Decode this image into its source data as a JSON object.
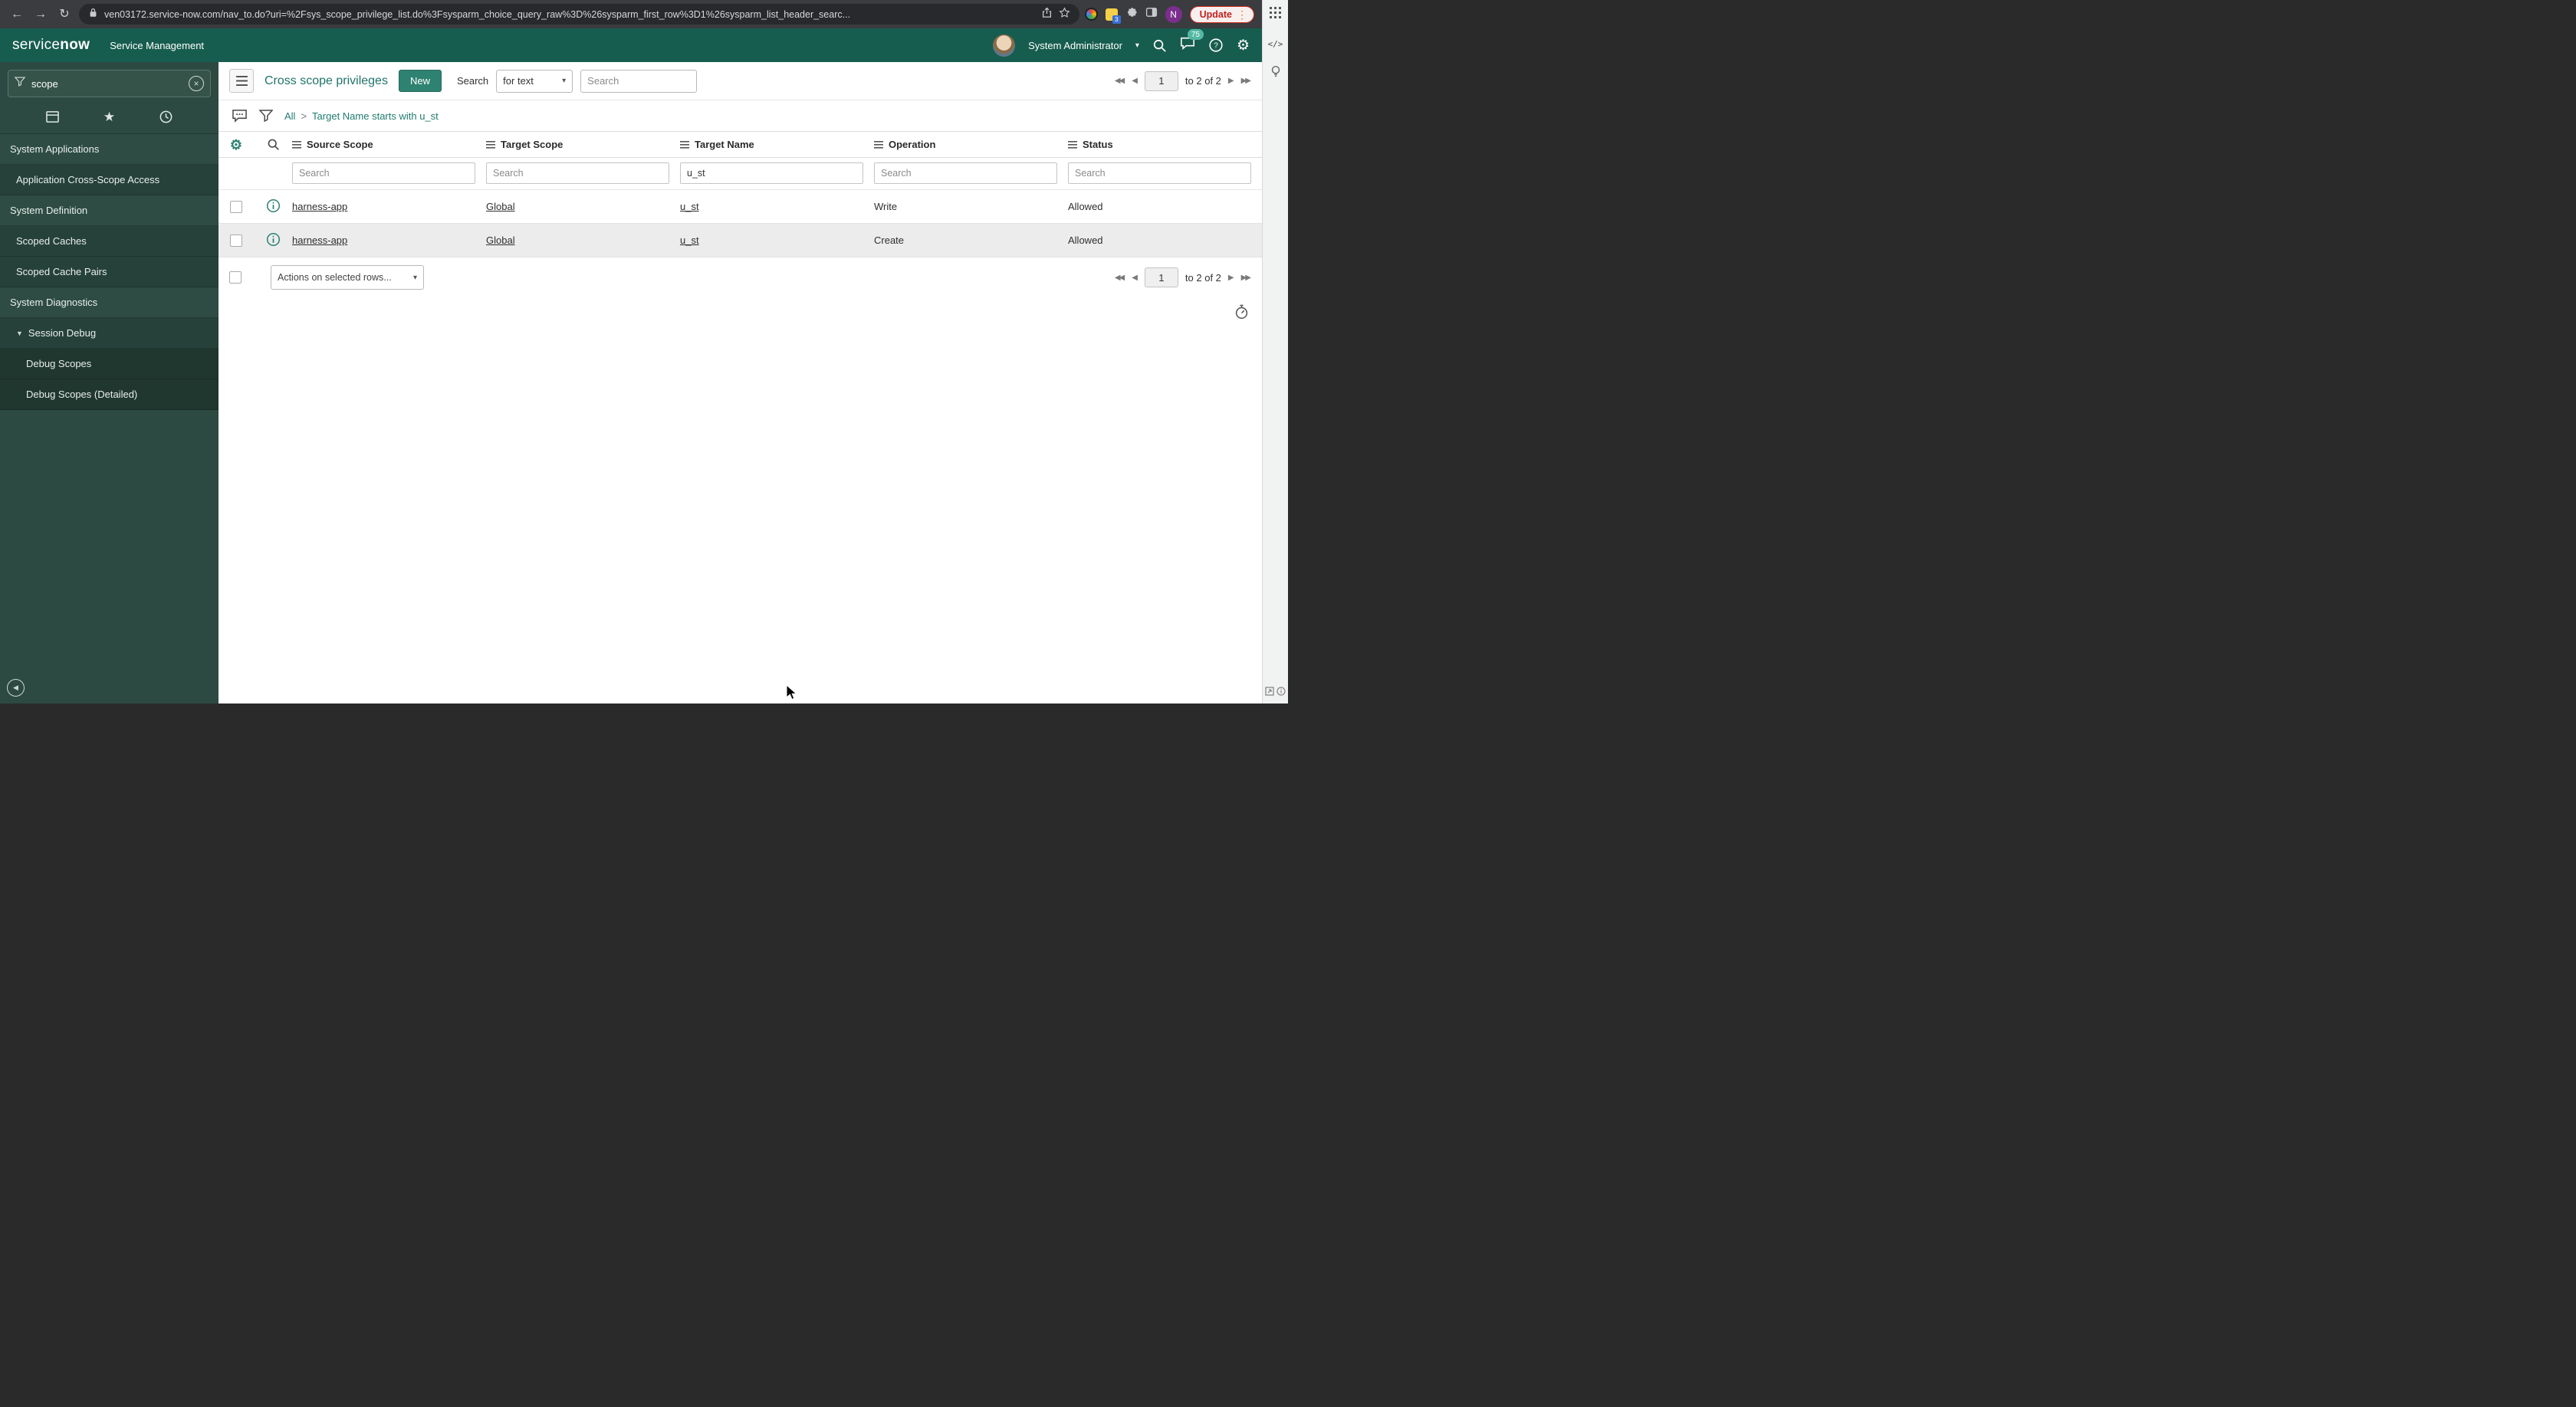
{
  "browser": {
    "url": "ven03172.service-now.com/nav_to.do?uri=%2Fsys_scope_privilege_list.do%3Fsysparm_choice_query_raw%3D%26sysparm_first_row%3D1%26sysparm_list_header_searc...",
    "update_label": "Update",
    "extension_badge": "3",
    "profile_initial": "N"
  },
  "app_header": {
    "logo_service": "service",
    "logo_now": "now",
    "product": "Service Management",
    "user_name": "System Administrator",
    "notification_count": "75"
  },
  "sidebar": {
    "search_value": "scope",
    "items": [
      {
        "label": "System Applications"
      },
      {
        "label": "Application Cross-Scope Access"
      },
      {
        "label": "System Definition"
      },
      {
        "label": "Scoped Caches"
      },
      {
        "label": "Scoped Cache Pairs"
      },
      {
        "label": "System Diagnostics"
      },
      {
        "label": "Session Debug"
      },
      {
        "label": "Debug Scopes"
      },
      {
        "label": "Debug Scopes (Detailed)"
      }
    ]
  },
  "list_header": {
    "title": "Cross scope privileges",
    "new_button": "New",
    "search_label": "Search",
    "search_type": "for text",
    "search_placeholder": "Search"
  },
  "breadcrumb": {
    "all": "All",
    "separator": ">",
    "condition": "Target Name starts with u_st"
  },
  "pagination": {
    "page": "1",
    "range_text": "to 2 of 2"
  },
  "table": {
    "filter_placeholder": "Search",
    "columns": [
      {
        "label": "Source Scope",
        "filter": ""
      },
      {
        "label": "Target Scope",
        "filter": ""
      },
      {
        "label": "Target Name",
        "filter": "u_st"
      },
      {
        "label": "Operation",
        "filter": ""
      },
      {
        "label": "Status",
        "filter": ""
      }
    ],
    "rows": [
      {
        "source_scope": "harness-app",
        "target_scope": "Global",
        "target_name": "u_st",
        "operation": "Write",
        "status": "Allowed"
      },
      {
        "source_scope": "harness-app",
        "target_scope": "Global",
        "target_name": "u_st",
        "operation": "Create",
        "status": "Allowed"
      }
    ],
    "actions_dropdown": "Actions on selected rows..."
  },
  "icons": {
    "back": "←",
    "forward": "→",
    "reload": "↻",
    "first_page": "◀◀",
    "prev_page": "◀",
    "next_page": "▶",
    "last_page": "▶▶",
    "gear": "⚙",
    "star": "★",
    "caret_down": "▾",
    "tree_caret": "▼",
    "kebab": "⋮",
    "clear": "×",
    "code": "</>",
    "collapse": "◀"
  },
  "colors": {
    "header_green": "#175d4f",
    "sidebar_green": "#2c4a41",
    "link_teal": "#1f7b6f",
    "accent_teal": "#2e8271"
  }
}
